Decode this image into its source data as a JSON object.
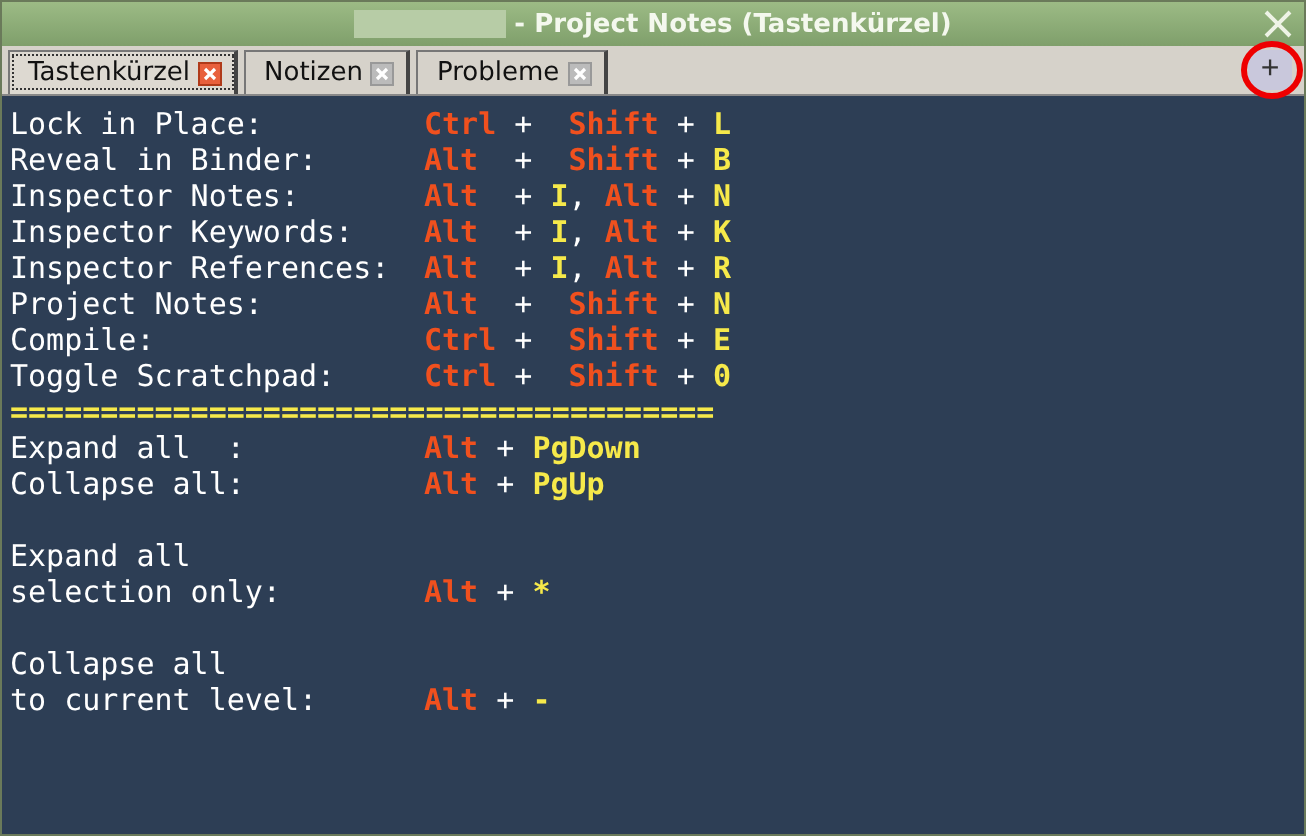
{
  "window": {
    "title": "- Project Notes (Tastenkürzel)"
  },
  "tabs": [
    {
      "label": "Tastenkürzel",
      "selected": true
    },
    {
      "label": "Notizen",
      "selected": false
    },
    {
      "label": "Probleme",
      "selected": false
    }
  ],
  "add_tab": {
    "label": "+",
    "highlighted": true
  },
  "lines": [
    {
      "kind": "shortcut",
      "label": "Lock in Place:",
      "keys": [
        {
          "kind": "mod",
          "text": "Ctrl"
        },
        {
          "kind": "plain",
          "text": " +  "
        },
        {
          "kind": "mod",
          "text": "Shift"
        },
        {
          "kind": "plain",
          "text": " + "
        },
        {
          "kind": "key",
          "text": "L"
        }
      ]
    },
    {
      "kind": "shortcut",
      "label": "Reveal in Binder:",
      "keys": [
        {
          "kind": "mod",
          "text": "Alt"
        },
        {
          "kind": "plain",
          "text": "  +  "
        },
        {
          "kind": "mod",
          "text": "Shift"
        },
        {
          "kind": "plain",
          "text": " + "
        },
        {
          "kind": "key",
          "text": "B"
        }
      ]
    },
    {
      "kind": "shortcut",
      "label": "Inspector Notes:",
      "keys": [
        {
          "kind": "mod",
          "text": "Alt"
        },
        {
          "kind": "plain",
          "text": "  + "
        },
        {
          "kind": "key",
          "text": "I"
        },
        {
          "kind": "plain",
          "text": ", "
        },
        {
          "kind": "mod",
          "text": "Alt"
        },
        {
          "kind": "plain",
          "text": " + "
        },
        {
          "kind": "key",
          "text": "N"
        }
      ]
    },
    {
      "kind": "shortcut",
      "label": "Inspector Keywords:",
      "keys": [
        {
          "kind": "mod",
          "text": "Alt"
        },
        {
          "kind": "plain",
          "text": "  + "
        },
        {
          "kind": "key",
          "text": "I"
        },
        {
          "kind": "plain",
          "text": ", "
        },
        {
          "kind": "mod",
          "text": "Alt"
        },
        {
          "kind": "plain",
          "text": " + "
        },
        {
          "kind": "key",
          "text": "K"
        }
      ]
    },
    {
      "kind": "shortcut",
      "label": "Inspector References:",
      "keys": [
        {
          "kind": "mod",
          "text": "Alt"
        },
        {
          "kind": "plain",
          "text": "  + "
        },
        {
          "kind": "key",
          "text": "I"
        },
        {
          "kind": "plain",
          "text": ", "
        },
        {
          "kind": "mod",
          "text": "Alt"
        },
        {
          "kind": "plain",
          "text": " + "
        },
        {
          "kind": "key",
          "text": "R"
        }
      ]
    },
    {
      "kind": "shortcut",
      "label": "Project Notes:",
      "keys": [
        {
          "kind": "mod",
          "text": "Alt"
        },
        {
          "kind": "plain",
          "text": "  +  "
        },
        {
          "kind": "mod",
          "text": "Shift"
        },
        {
          "kind": "plain",
          "text": " + "
        },
        {
          "kind": "key",
          "text": "N"
        }
      ]
    },
    {
      "kind": "shortcut",
      "label": "Compile:",
      "keys": [
        {
          "kind": "mod",
          "text": "Ctrl"
        },
        {
          "kind": "plain",
          "text": " +  "
        },
        {
          "kind": "mod",
          "text": "Shift"
        },
        {
          "kind": "plain",
          "text": " + "
        },
        {
          "kind": "key",
          "text": "E"
        }
      ]
    },
    {
      "kind": "shortcut",
      "label": "Toggle Scratchpad:",
      "keys": [
        {
          "kind": "mod",
          "text": "Ctrl"
        },
        {
          "kind": "plain",
          "text": " +  "
        },
        {
          "kind": "mod",
          "text": "Shift"
        },
        {
          "kind": "plain",
          "text": " + "
        },
        {
          "kind": "key",
          "text": "0"
        }
      ]
    },
    {
      "kind": "rule",
      "text": "======================================="
    },
    {
      "kind": "shortcut",
      "label": "Expand all  :",
      "keys": [
        {
          "kind": "mod",
          "text": "Alt"
        },
        {
          "kind": "plain",
          "text": " + "
        },
        {
          "kind": "key",
          "text": "PgDown"
        }
      ]
    },
    {
      "kind": "shortcut",
      "label": "Collapse all:",
      "keys": [
        {
          "kind": "mod",
          "text": "Alt"
        },
        {
          "kind": "plain",
          "text": " + "
        },
        {
          "kind": "key",
          "text": "PgUp"
        }
      ]
    },
    {
      "kind": "blank"
    },
    {
      "kind": "shortcut",
      "label": "Expand all"
    },
    {
      "kind": "shortcut",
      "label": "selection only:",
      "keys": [
        {
          "kind": "mod",
          "text": "Alt"
        },
        {
          "kind": "plain",
          "text": " + "
        },
        {
          "kind": "key",
          "text": "*"
        }
      ]
    },
    {
      "kind": "blank"
    },
    {
      "kind": "shortcut",
      "label": "Collapse all"
    },
    {
      "kind": "shortcut",
      "label": "to current level:",
      "keys": [
        {
          "kind": "mod",
          "text": "Alt"
        },
        {
          "kind": "plain",
          "text": " + "
        },
        {
          "kind": "key",
          "text": "-"
        }
      ]
    }
  ]
}
